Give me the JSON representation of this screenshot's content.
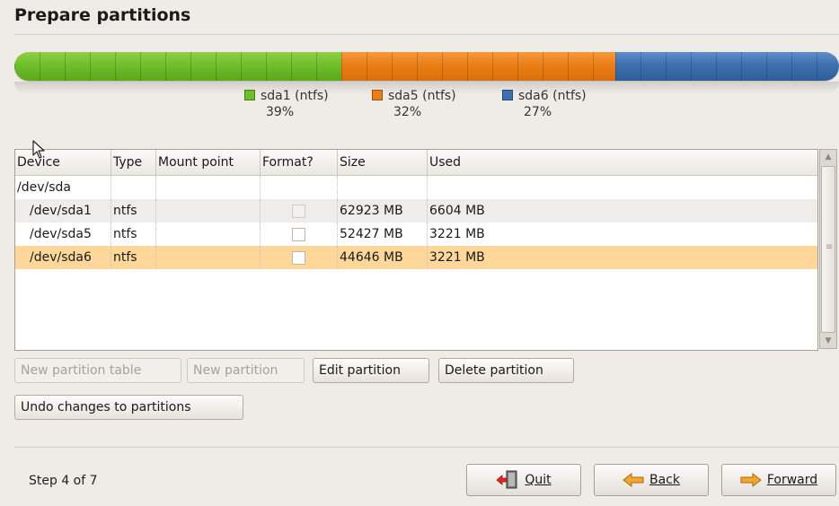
{
  "header": {
    "title": "Prepare partitions"
  },
  "partition_bar": {
    "segments": [
      {
        "name": "sda1 (ntfs)",
        "percent": "39%",
        "color": "#6fbe2a"
      },
      {
        "name": "sda5 (ntfs)",
        "percent": "32%",
        "color": "#ec7e17"
      },
      {
        "name": "sda6 (ntfs)",
        "percent": "27%",
        "color": "#3e6fae"
      }
    ]
  },
  "table": {
    "columns": [
      "Device",
      "Type",
      "Mount point",
      "Format?",
      "Size",
      "Used"
    ],
    "rows": [
      {
        "device": "/dev/sda",
        "type": "",
        "mount": "",
        "format": "",
        "size": "",
        "used": ""
      },
      {
        "device": "/dev/sda1",
        "type": "ntfs",
        "mount": "",
        "format": "unchecked",
        "size": "62923 MB",
        "used": "6604 MB"
      },
      {
        "device": "/dev/sda5",
        "type": "ntfs",
        "mount": "",
        "format": "unchecked",
        "size": "52427 MB",
        "used": "3221 MB"
      },
      {
        "device": "/dev/sda6",
        "type": "ntfs",
        "mount": "",
        "format": "unchecked",
        "size": "44646 MB",
        "used": "3221 MB",
        "selected": true
      }
    ]
  },
  "actions": {
    "new_partition_table": "New partition table",
    "new_partition": "New partition",
    "edit_partition": "Edit partition",
    "delete_partition": "Delete partition",
    "undo_changes": "Undo changes to partitions"
  },
  "footer": {
    "step": "Step 4 of 7",
    "quit": "Quit",
    "back": "Back",
    "forward": "Forward"
  }
}
